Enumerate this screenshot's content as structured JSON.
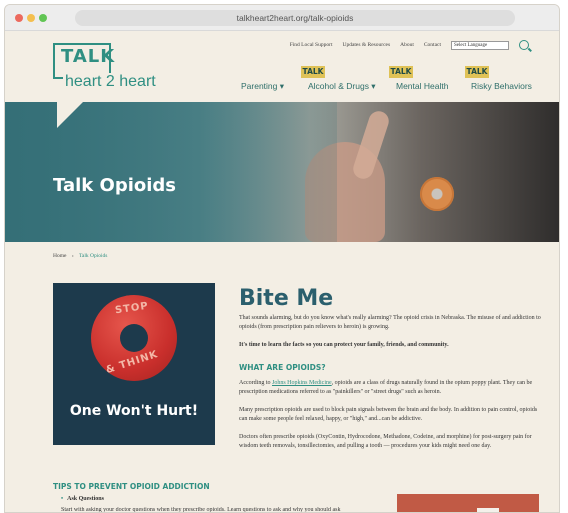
{
  "browser": {
    "url": "talkheart2heart.org/talk-opioids"
  },
  "utility_nav": {
    "items": [
      "Find Local Support",
      "Updates & Resources",
      "About",
      "Contact"
    ],
    "language_select": "Select Language"
  },
  "logo": {
    "talk": "TALK",
    "tagline": "heart 2 heart"
  },
  "main_nav": {
    "parenting": "Parenting ▾",
    "alcohol": "Alcohol & Drugs ▾",
    "mental": "Mental Health",
    "risky": "Risky Behaviors",
    "talk_tag": "TALK"
  },
  "hero": {
    "title": "Talk Opioids"
  },
  "breadcrumb": {
    "home": "Home",
    "sep": "›",
    "current": "Talk Opioids"
  },
  "poster": {
    "ring_top": "STOP",
    "ring_bottom": "& THINK",
    "tagline": "One Won't Hurt!"
  },
  "article": {
    "title": "Bite Me",
    "intro": "That sounds alarming, but do you know what's really alarming? The opioid crisis in Nebraska. The misuse of and addiction to opioids (from prescription pain relievers to heroin) is growing.",
    "lead": "It's time to learn the facts so you can protect your family, friends, and community.",
    "section_heading": "WHAT ARE OPIOIDS?",
    "p1_before": "According to ",
    "p1_link": "Johns Hopkins Medicine",
    "p1_after": ", opioids are a class of drugs naturally found in the opium poppy plant. They can be prescription medications referred to as \"painkillers\" or \"street drugs\" such as heroin.",
    "p2": "Many prescription opioids are used to block pain signals between the brain and the body. In addition to pain control, opioids can make some people feel relaxed, happy, or \"high,\" and...can be addictive.",
    "p3": "Doctors often prescribe opioids (OxyContin, Hydrocodone, Methadone, Codeine, and morphine) for post-surgery pain for wisdom teeth removals, tonsillectomies, and pulling a tooth — procedures your kids might need one day."
  },
  "tips": {
    "heading": "TIPS TO PREVENT OPIOID ADDICTION",
    "item1_title": "Ask Questions",
    "item1_desc": "Start with asking your doctor questions when they prescribe opioids. Learn questions to ask and why you should ask"
  },
  "colors": {
    "teal": "#2f8f82",
    "cream": "#f3eee4",
    "mustard": "#dfc257",
    "navy": "#1d3a4c",
    "red": "#c92f2c"
  }
}
